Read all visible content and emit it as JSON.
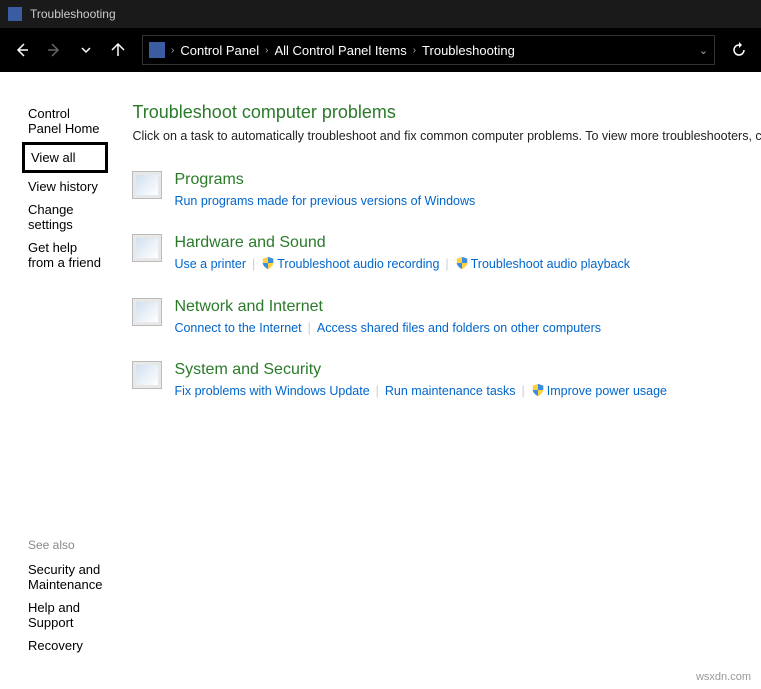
{
  "titlebar": {
    "title": "Troubleshooting"
  },
  "breadcrumb": {
    "items": [
      "Control Panel",
      "All Control Panel Items",
      "Troubleshooting"
    ]
  },
  "sidebar": {
    "items": [
      {
        "label": "Control Panel Home"
      },
      {
        "label": "View all"
      },
      {
        "label": "View history"
      },
      {
        "label": "Change settings"
      },
      {
        "label": "Get help from a friend"
      }
    ],
    "seealso": {
      "title": "See also",
      "items": [
        "Security and Maintenance",
        "Help and Support",
        "Recovery"
      ]
    }
  },
  "main": {
    "heading": "Troubleshoot computer problems",
    "subtitle": "Click on a task to automatically troubleshoot and fix common computer problems. To view more troubleshooters, click on a category or use the Search box.",
    "categories": [
      {
        "title": "Programs",
        "links": [
          {
            "label": "Run programs made for previous versions of Windows",
            "shield": false
          }
        ]
      },
      {
        "title": "Hardware and Sound",
        "links": [
          {
            "label": "Use a printer",
            "shield": false
          },
          {
            "label": "Troubleshoot audio recording",
            "shield": true
          },
          {
            "label": "Troubleshoot audio playback",
            "shield": true
          }
        ]
      },
      {
        "title": "Network and Internet",
        "links": [
          {
            "label": "Connect to the Internet",
            "shield": false
          },
          {
            "label": "Access shared files and folders on other computers",
            "shield": false
          }
        ]
      },
      {
        "title": "System and Security",
        "links": [
          {
            "label": "Fix problems with Windows Update",
            "shield": false
          },
          {
            "label": "Run maintenance tasks",
            "shield": false
          },
          {
            "label": "Improve power usage",
            "shield": true
          }
        ]
      }
    ]
  },
  "watermark": "wsxdn.com"
}
